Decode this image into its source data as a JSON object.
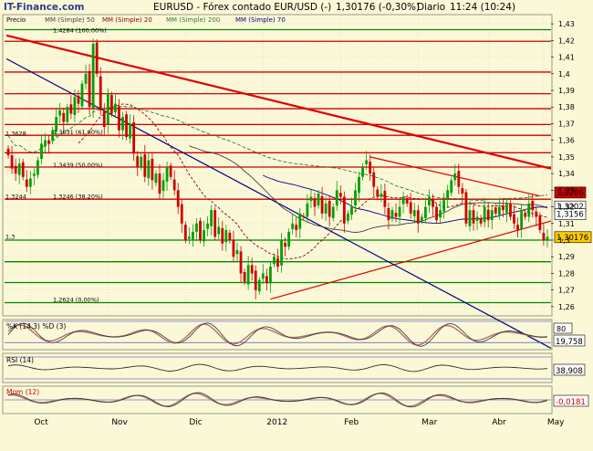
{
  "header": {
    "brand": "IT-Finance.com",
    "title": "EURUSD - Fórex contado EUR/USD (-)",
    "last": "1,30176 (-0,30%)",
    "period": "Diario",
    "time": "11:24 (10:24)"
  },
  "legend": {
    "price": "Precio",
    "ma50": "MM (Simple) 50",
    "ma20": "MM (Simple) 20",
    "ma200": "MM (Simple) 200",
    "ma70": "MM (Simple) 70"
  },
  "colors": {
    "background": "#fbf8d8",
    "bull": "#00a000",
    "bear": "#cc0000",
    "hline_red": "#d00000",
    "hline_green": "#008800",
    "trend": "#e00000",
    "ma20": "#8b0000",
    "ma50": "#404040",
    "ma200": "#2e7d32",
    "ma70": "#000080",
    "indicator": "#2f2f2f"
  },
  "chart_data": {
    "type": "candlestick",
    "title": "EURUSD - Fórex contado EUR/USD (-)",
    "ylim": [
      1.255,
      1.435
    ],
    "yticks": [
      "1,43",
      "1,42",
      "1,41",
      "1,4",
      "1,39",
      "1,38",
      "1,37",
      "1,36",
      "1,35",
      "1,34",
      "1,33",
      "1,32",
      "1,31",
      "1,3",
      "1,29",
      "1,28",
      "1,27",
      "1,26"
    ],
    "xticks": [
      "Oct",
      "Nov",
      "Dic",
      "2012",
      "Feb",
      "Mar",
      "Abr",
      "May"
    ],
    "price_markers": [
      {
        "label": "1,3286",
        "value": 1.3286,
        "color": "#d00000"
      },
      {
        "label": "1,3202",
        "value": 1.3202,
        "color": "#ffffff"
      },
      {
        "label": "1,3156",
        "value": 1.3156,
        "color": "#ffffff"
      },
      {
        "label": "1,30176",
        "value": 1.30176,
        "color": "#ffcc00"
      }
    ],
    "fib_labels": [
      {
        "text": "1,4284 (100,00%)",
        "value": 1.4265
      },
      {
        "text": "1,3631 (61,80%)",
        "value": 1.3652
      },
      {
        "text": "1,3439 (50,00%)",
        "value": 1.3455
      },
      {
        "text": "1,3246 (38,20%)",
        "value": 1.3265
      },
      {
        "text": "1,2624 (0,00%)",
        "value": 1.2645
      }
    ],
    "left_labels": [
      {
        "text": "1,3628",
        "value": 1.3645
      },
      {
        "text": "1,3244",
        "value": 1.3265
      },
      {
        "text": "1,3",
        "value": 1.3025
      }
    ],
    "hlines": [
      {
        "value": 1.4265,
        "color": "#008800"
      },
      {
        "value": 1.4195,
        "color": "#d00000"
      },
      {
        "value": 1.401,
        "color": "#d00000"
      },
      {
        "value": 1.388,
        "color": "#d00000"
      },
      {
        "value": 1.379,
        "color": "#d00000"
      },
      {
        "value": 1.3695,
        "color": "#d00000"
      },
      {
        "value": 1.363,
        "color": "#d00000"
      },
      {
        "value": 1.3525,
        "color": "#d00000"
      },
      {
        "value": 1.3439,
        "color": "#d00000"
      },
      {
        "value": 1.3246,
        "color": "#d00000"
      },
      {
        "value": 1.3,
        "color": "#008800"
      },
      {
        "value": 1.287,
        "color": "#008800"
      },
      {
        "value": 1.2745,
        "color": "#008800"
      },
      {
        "value": 1.2624,
        "color": "#008800"
      }
    ],
    "trend_lines": [
      {
        "from": [
          -0.5,
          1.423
        ],
        "to": [
          147,
          1.343
        ],
        "color": "#e00000"
      },
      {
        "from": [
          71,
          1.2645
        ],
        "to": [
          147,
          1.3115
        ],
        "color": "#e00000"
      },
      {
        "from": [
          98,
          1.35
        ],
        "to": [
          144,
          1.3265
        ],
        "color": "#e00000"
      },
      {
        "from": [
          -0.5,
          1.409
        ],
        "to": [
          147,
          1.235
        ],
        "color": "#000080"
      }
    ],
    "closes": [
      1.351,
      1.343,
      1.34,
      1.346,
      1.338,
      1.332,
      1.337,
      1.34,
      1.348,
      1.358,
      1.36,
      1.358,
      1.366,
      1.374,
      1.378,
      1.371,
      1.38,
      1.376,
      1.386,
      1.382,
      1.394,
      1.4,
      1.38,
      1.418,
      1.4,
      1.378,
      1.368,
      1.388,
      1.376,
      1.382,
      1.366,
      1.374,
      1.362,
      1.37,
      1.352,
      1.344,
      1.35,
      1.338,
      1.348,
      1.336,
      1.34,
      1.328,
      1.336,
      1.344,
      1.338,
      1.33,
      1.32,
      1.31,
      1.3,
      1.302,
      1.305,
      1.31,
      1.3,
      1.306,
      1.31,
      1.318,
      1.302,
      1.308,
      1.298,
      1.306,
      1.3,
      1.29,
      1.294,
      1.28,
      1.275,
      1.285,
      1.28,
      1.27,
      1.276,
      1.28,
      1.274,
      1.284,
      1.29,
      1.284,
      1.3,
      1.296,
      1.305,
      1.31,
      1.306,
      1.316,
      1.314,
      1.322,
      1.326,
      1.32,
      1.328,
      1.316,
      1.322,
      1.314,
      1.32,
      1.33,
      1.326,
      1.31,
      1.316,
      1.32,
      1.33,
      1.338,
      1.344,
      1.348,
      1.34,
      1.332,
      1.326,
      1.328,
      1.32,
      1.312,
      1.318,
      1.314,
      1.32,
      1.326,
      1.322,
      1.316,
      1.318,
      1.31,
      1.314,
      1.32,
      1.326,
      1.32,
      1.312,
      1.318,
      1.324,
      1.33,
      1.336,
      1.34,
      1.332,
      1.328,
      1.31,
      1.318,
      1.31,
      1.314,
      1.31,
      1.32,
      1.312,
      1.318,
      1.316,
      1.32,
      1.318,
      1.322,
      1.314,
      1.31,
      1.306,
      1.318,
      1.314,
      1.322,
      1.318,
      1.314,
      1.306,
      1.3,
      1.302
    ],
    "indicators": [
      {
        "name": "%K",
        "label": "%K (14,3) %D (3)",
        "value": "19,758",
        "ref": "80",
        "ylim": [
          0,
          100
        ]
      },
      {
        "name": "RSI",
        "label": "RSI (14)",
        "value": "38,908",
        "ylim": [
          0,
          100
        ]
      },
      {
        "name": "Mom",
        "label": "Mom (12)",
        "value": "-0,0181",
        "ylim": [
          -0.08,
          0.08
        ]
      }
    ]
  }
}
